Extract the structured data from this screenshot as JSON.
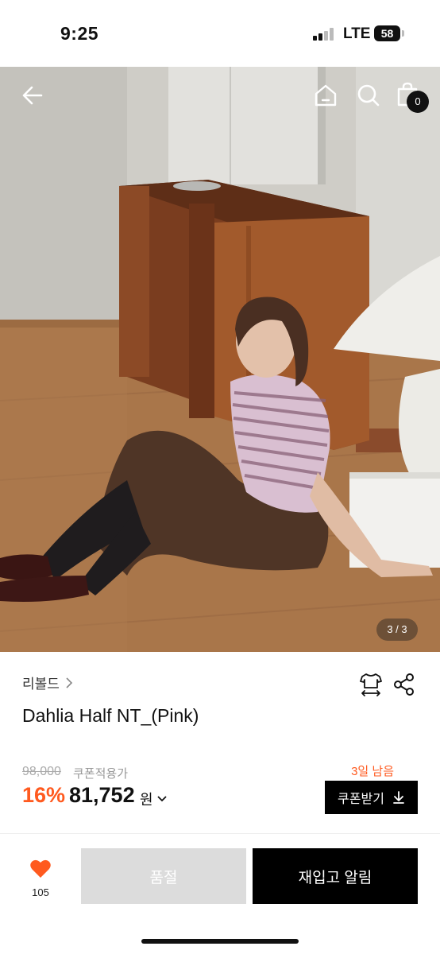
{
  "status_bar": {
    "time": "9:25",
    "network": "LTE",
    "battery": "58"
  },
  "header": {
    "cart_count": "0"
  },
  "gallery": {
    "indicator": "3 / 3"
  },
  "product": {
    "brand": "리볼드",
    "name": "Dahlia Half NT_(Pink)",
    "original_price": "98,000",
    "coupon_note": "쿠폰적용가",
    "discount": "16%",
    "sale_price": "81,752",
    "currency": "원",
    "days_left": "3일 남음",
    "coupon_button": "쿠폰받기"
  },
  "bottom_bar": {
    "like_count": "105",
    "soldout_label": "품절",
    "restock_label": "재입고 알림"
  },
  "colors": {
    "accent": "#ff5a1f",
    "like": "#ff5a1f",
    "dark": "#000000"
  },
  "icons": [
    "back-arrow-icon",
    "home-icon",
    "search-icon",
    "cart-icon",
    "size-guide-icon",
    "share-icon",
    "chevron-right-icon",
    "chevron-down-icon",
    "download-icon",
    "heart-icon"
  ]
}
